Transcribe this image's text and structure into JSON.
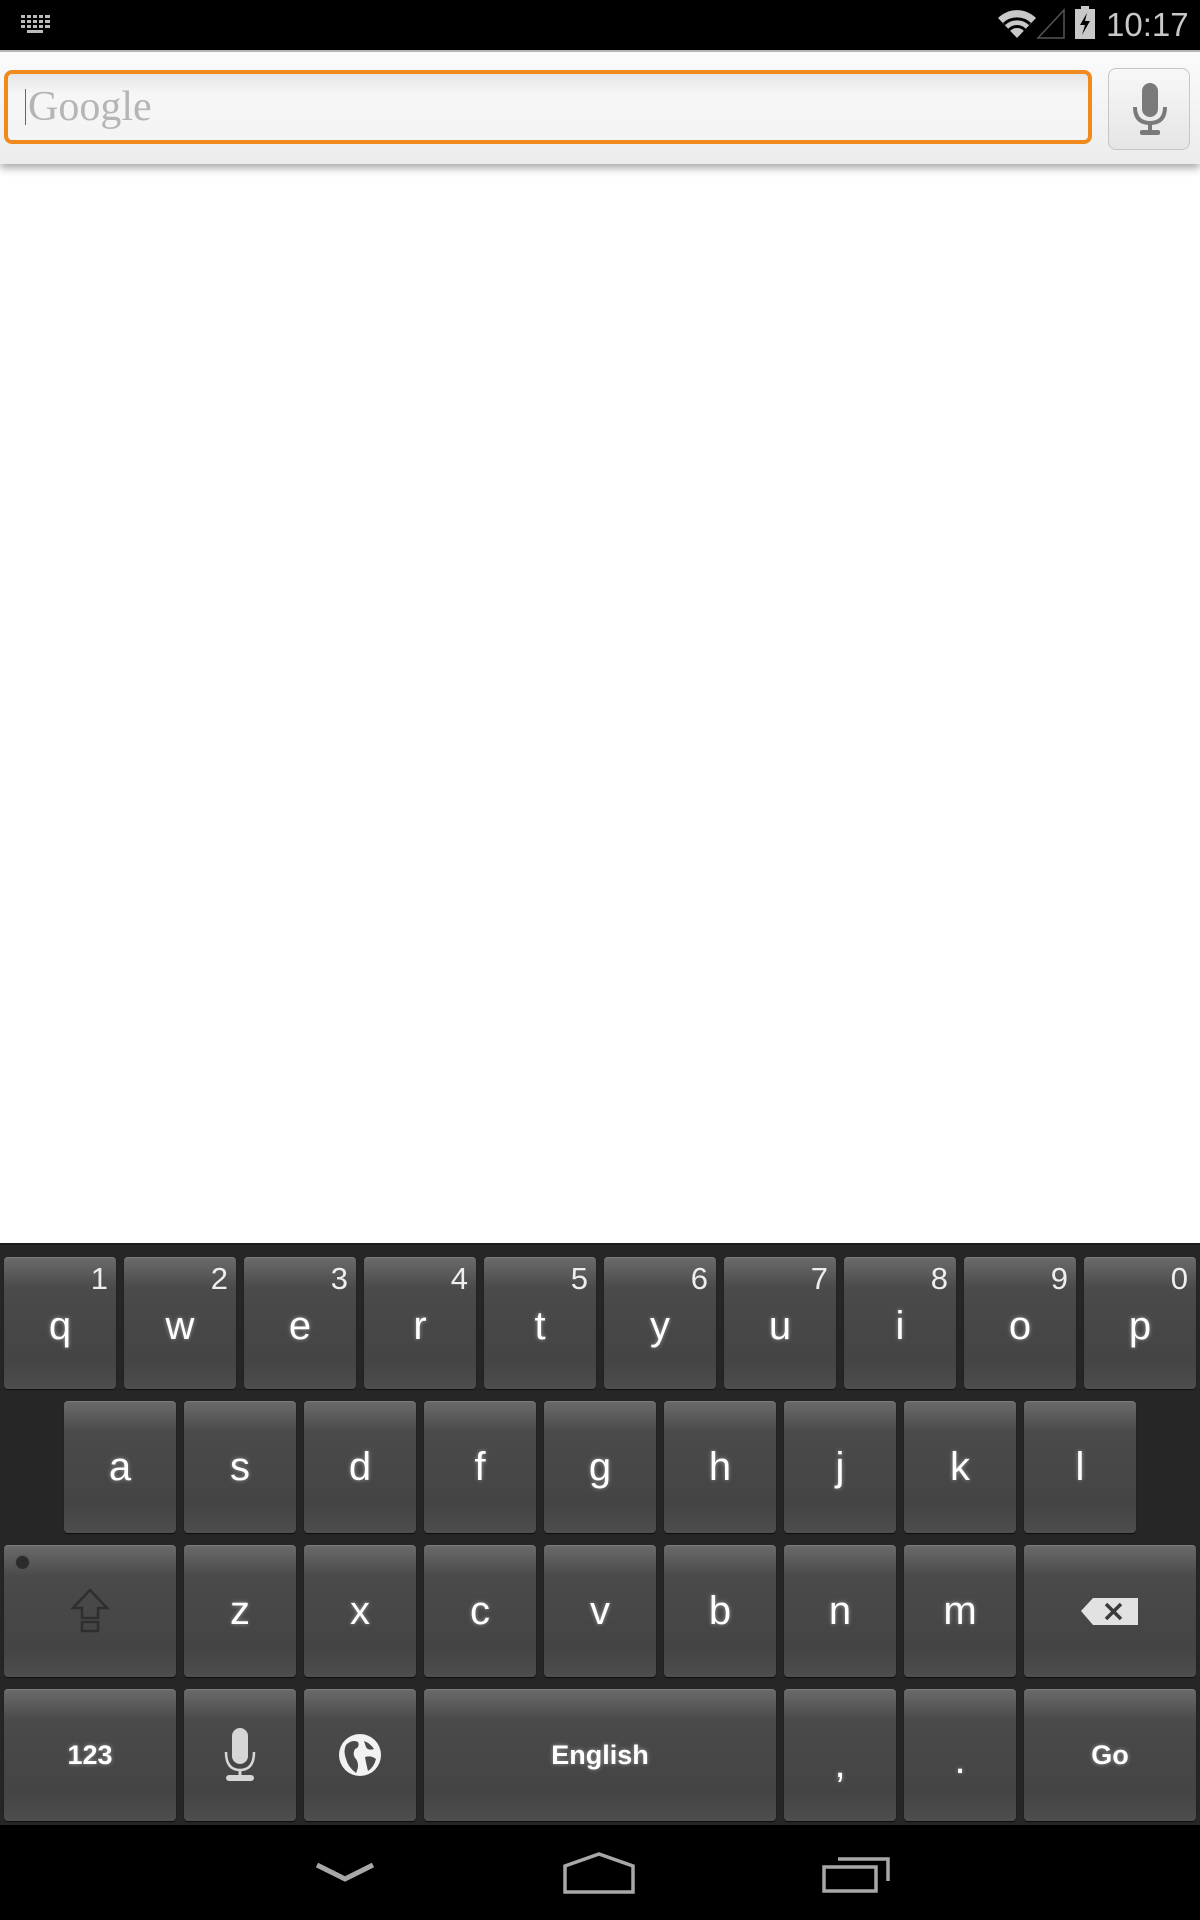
{
  "status_bar": {
    "time": "10:17",
    "icons": [
      "keyboard-notification-icon",
      "wifi-icon",
      "cell-signal-icon",
      "battery-charging-icon"
    ]
  },
  "search": {
    "placeholder": "Google",
    "value": "",
    "accent_color": "#f08a1c",
    "voice_button_icon": "microphone-icon"
  },
  "keyboard": {
    "row1": [
      {
        "key": "q",
        "hint": "1"
      },
      {
        "key": "w",
        "hint": "2"
      },
      {
        "key": "e",
        "hint": "3"
      },
      {
        "key": "r",
        "hint": "4"
      },
      {
        "key": "t",
        "hint": "5"
      },
      {
        "key": "y",
        "hint": "6"
      },
      {
        "key": "u",
        "hint": "7"
      },
      {
        "key": "i",
        "hint": "8"
      },
      {
        "key": "o",
        "hint": "9"
      },
      {
        "key": "p",
        "hint": "0"
      }
    ],
    "row2": [
      "a",
      "s",
      "d",
      "f",
      "g",
      "h",
      "j",
      "k",
      "l"
    ],
    "row3": [
      "z",
      "x",
      "c",
      "v",
      "b",
      "n",
      "m"
    ],
    "shift_icon": "shift-icon",
    "delete_icon": "backspace-icon",
    "symbols_label": "123",
    "mic_icon": "microphone-icon",
    "language_icon": "globe-icon",
    "space_label": "English",
    "comma": ",",
    "period": ".",
    "action_label": "Go"
  },
  "nav_bar": {
    "buttons": [
      "back-icon",
      "home-icon",
      "recent-apps-icon"
    ]
  }
}
